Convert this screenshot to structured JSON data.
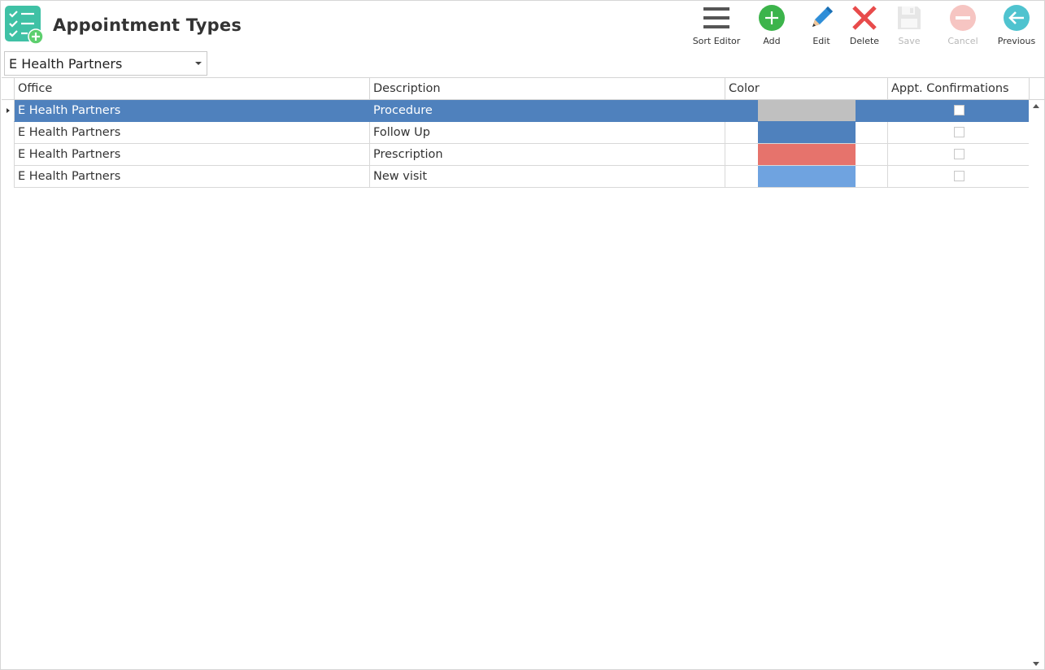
{
  "header": {
    "title": "Appointment Types",
    "app_icon": "checklist-add-icon"
  },
  "toolbar": {
    "sort_editor": {
      "label": "Sort Editor",
      "icon": "hamburger-menu-icon",
      "enabled": true
    },
    "add": {
      "label": "Add",
      "icon": "plus-circle-icon",
      "enabled": true
    },
    "edit": {
      "label": "Edit",
      "icon": "pencil-icon",
      "enabled": true
    },
    "delete": {
      "label": "Delete",
      "icon": "red-x-icon",
      "enabled": true
    },
    "save": {
      "label": "Save",
      "icon": "floppy-disk-icon",
      "enabled": false
    },
    "cancel": {
      "label": "Cancel",
      "icon": "minus-circle-icon",
      "enabled": false
    },
    "previous": {
      "label": "Previous",
      "icon": "arrow-left-circle-icon",
      "enabled": true
    }
  },
  "office_select": {
    "value": "E Health Partners"
  },
  "grid": {
    "columns": [
      "Office",
      "Description",
      "Color",
      "Appt. Confirmations"
    ],
    "rows": [
      {
        "office": "E Health Partners",
        "description": "Procedure",
        "color": "#c0c0c0",
        "confirmations": false,
        "selected": true
      },
      {
        "office": "E Health Partners",
        "description": "Follow Up",
        "color": "#4f81bd",
        "confirmations": false,
        "selected": false
      },
      {
        "office": "E Health Partners",
        "description": "Prescription",
        "color": "#e6736c",
        "confirmations": false,
        "selected": false
      },
      {
        "office": "E Health Partners",
        "description": "New visit",
        "color": "#6fa3e0",
        "confirmations": false,
        "selected": false
      }
    ]
  },
  "colors": {
    "selection": "#4f81bd",
    "add_green": "#3cb44b",
    "delete_red": "#e84b4b",
    "edit_blue": "#2f8ed8",
    "previous_teal": "#4fc3cf",
    "app_icon_teal": "#3fc1a5"
  }
}
